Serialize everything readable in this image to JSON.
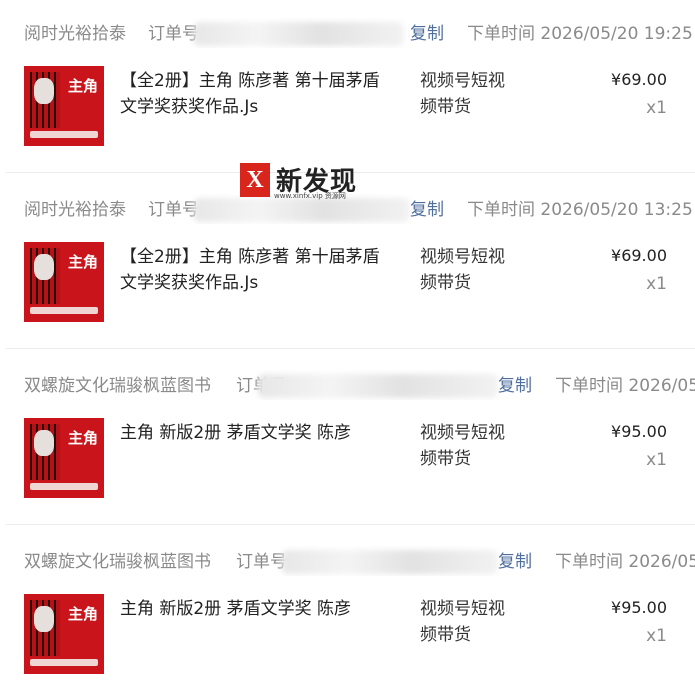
{
  "orders": [
    {
      "shop": "阅时光裕拾泰",
      "order_prefix": "订单号",
      "copy_label": "复制",
      "order_time": "下单时间 2026/05/20 19:25",
      "product_title": "【全2册】主角 陈彦著 第十届茅盾文学奖获奖作品.Js",
      "channel": "视频号短视频带货",
      "price": "¥69.00",
      "qty": "x1",
      "cover_label": "主角"
    },
    {
      "shop": "阅时光裕拾泰",
      "order_prefix": "订单号",
      "copy_label": "复制",
      "order_time": "下单时间 2026/05/20 13:25",
      "product_title": "【全2册】主角 陈彦著 第十届茅盾文学奖获奖作品.Js",
      "channel": "视频号短视频带货",
      "price": "¥69.00",
      "qty": "x1",
      "cover_label": "主角"
    },
    {
      "shop": "双螺旋文化瑞骏枫蓝图书",
      "order_prefix": "订单号",
      "copy_label": "复制",
      "order_time": "下单时间 2026/05",
      "product_title": "主角 新版2册 茅盾文学奖 陈彦",
      "channel": "视频号短视频带货",
      "price": "¥95.00",
      "qty": "x1",
      "cover_label": "主角"
    },
    {
      "shop": "双螺旋文化瑞骏枫蓝图书",
      "order_prefix": "订单号",
      "copy_label": "复制",
      "order_time": "下单时间 2026/05",
      "product_title": "主角 新版2册 茅盾文学奖 陈彦",
      "channel": "视频号短视频带货",
      "price": "¥95.00",
      "qty": "x1",
      "cover_label": "主角"
    }
  ],
  "watermark": {
    "mark": "X",
    "text": "新发现",
    "url": "www.xinfx.vip 资源网"
  },
  "colors": {
    "muted_text": "#8a8a8a",
    "copy_link": "#4e6e9c",
    "cover_red": "#c8141a",
    "divider": "#ececec"
  }
}
